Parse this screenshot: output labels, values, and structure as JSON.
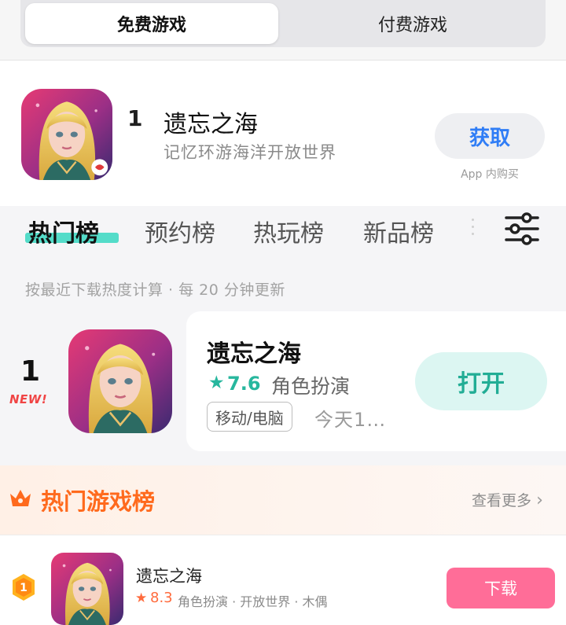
{
  "segmented": {
    "tabs": [
      "免费游戏",
      "付费游戏"
    ],
    "selected": "免费游戏"
  },
  "featured_app": {
    "rank": "1",
    "name": "遗忘之海",
    "subtitle": "记忆环游海洋开放世界",
    "action": "获取",
    "iap_note": "App 内购买",
    "icon": "game-icon-blonde-girl"
  },
  "ranking": {
    "tabs": [
      "热门榜",
      "预约榜",
      "热玩榜",
      "新品榜"
    ],
    "selected_tab": "热门榜",
    "filter_icon": "sliders-icon",
    "note": "按最近下载热度计算 · 每 20 分钟更新",
    "item": {
      "rank": "1",
      "badge": "NEW!",
      "name": "遗忘之海",
      "star": "★",
      "score": "7.6",
      "genre": "角色扮演",
      "platform": "移动/电脑",
      "date": "今天1…",
      "action": "打开"
    }
  },
  "hot_games": {
    "title": "热门游戏榜",
    "more": "查看更多",
    "more_chevron": "›",
    "item": {
      "rank": "1",
      "name": "遗忘之海",
      "star": "★",
      "score": "8.3",
      "tags": "角色扮演 · 开放世界 · 木偶",
      "action": "下载"
    }
  },
  "colors": {
    "accent_teal": "#27b79e",
    "get_blue": "#2f7df6",
    "hot_orange": "#ff6a1d",
    "download_pink": "#ff6d98",
    "new_red": "#f04545"
  }
}
